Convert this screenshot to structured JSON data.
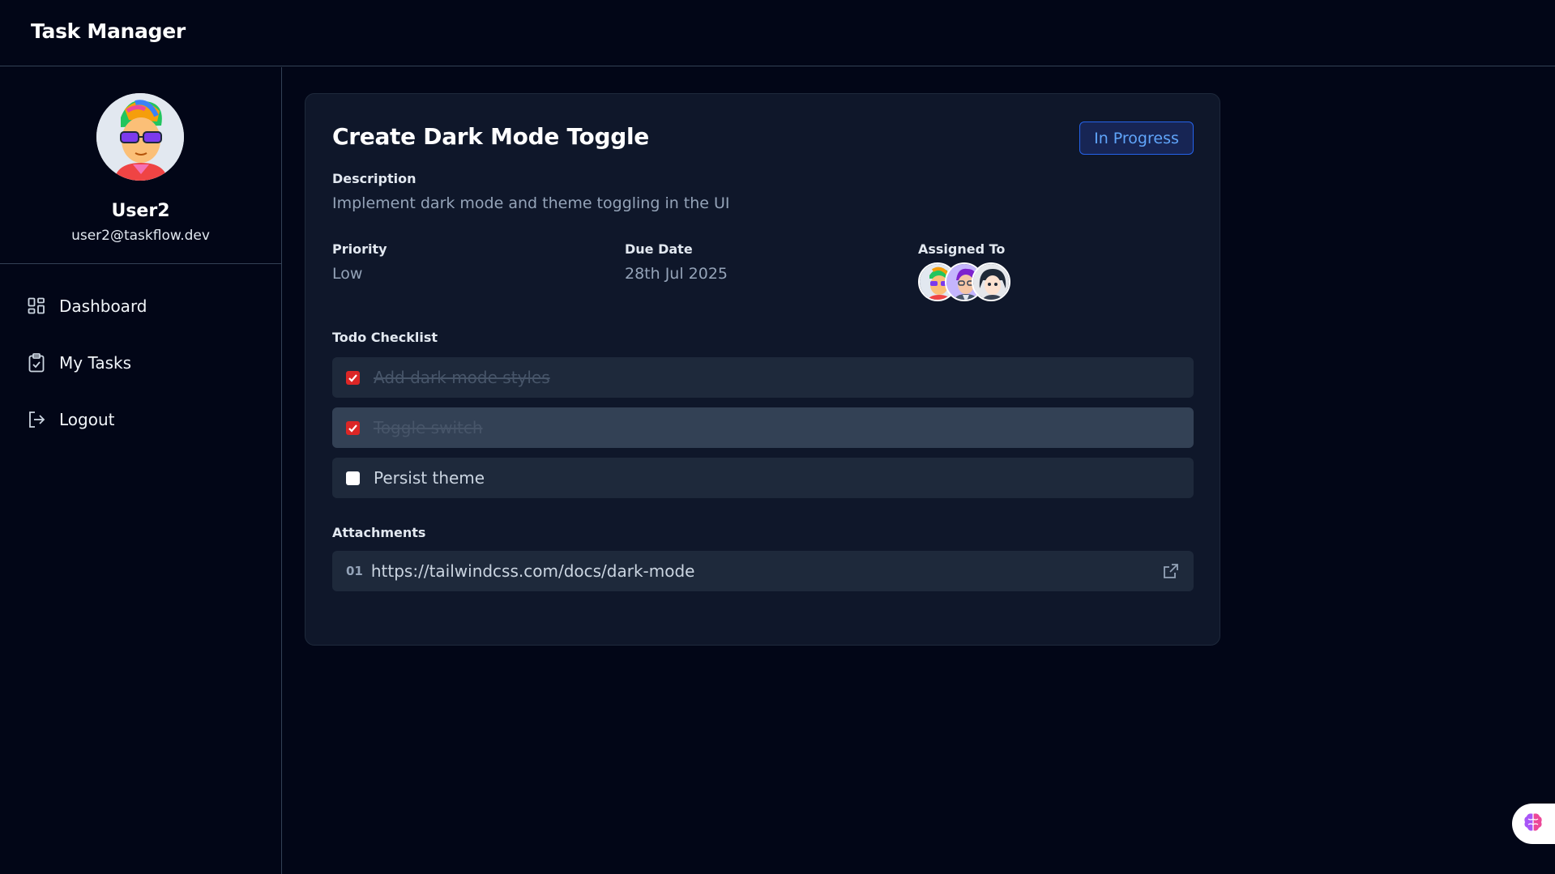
{
  "app": {
    "title": "Task Manager"
  },
  "user": {
    "name": "User2",
    "email": "user2@taskflow.dev"
  },
  "nav": [
    {
      "label": "Dashboard",
      "icon": "dashboard-grid-icon"
    },
    {
      "label": "My Tasks",
      "icon": "clipboard-check-icon"
    },
    {
      "label": "Logout",
      "icon": "logout-icon"
    }
  ],
  "task": {
    "title": "Create Dark Mode Toggle",
    "status": "In Progress",
    "description_label": "Description",
    "description": "Implement dark mode and theme toggling in the UI",
    "priority_label": "Priority",
    "priority": "Low",
    "due_label": "Due Date",
    "due": "28th Jul 2025",
    "assigned_label": "Assigned To",
    "checklist_label": "Todo Checklist",
    "checklist": [
      {
        "text": "Add dark mode styles",
        "done": true
      },
      {
        "text": "Toggle switch",
        "done": true
      },
      {
        "text": "Persist theme",
        "done": false
      }
    ],
    "attachments_label": "Attachments",
    "attachments": [
      {
        "num": "01",
        "url": "https://tailwindcss.com/docs/dark-mode"
      }
    ]
  },
  "colors": {
    "background": "#020617",
    "card": "#0f172a",
    "status_blue": "#60a5fa",
    "check_red": "#dc2626"
  }
}
